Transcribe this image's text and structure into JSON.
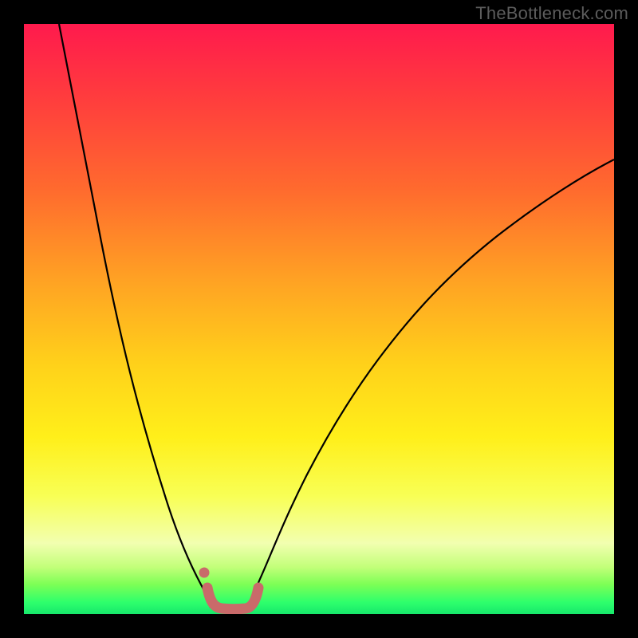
{
  "watermark": "TheBottleneck.com",
  "chart_data": {
    "type": "line",
    "title": "",
    "xlabel": "",
    "ylabel": "",
    "xlim": [
      0,
      100
    ],
    "ylim": [
      0,
      100
    ],
    "grid": false,
    "legend": false,
    "series": [
      {
        "name": "left-curve",
        "color": "#000000",
        "x": [
          6,
          8,
          10,
          12,
          14,
          16,
          18,
          20,
          22,
          24,
          26,
          28,
          30,
          31.5
        ],
        "y": [
          100,
          89,
          78,
          68,
          58,
          49,
          40,
          32,
          25,
          18,
          12,
          7,
          3,
          1
        ]
      },
      {
        "name": "right-curve",
        "color": "#000000",
        "x": [
          38,
          40,
          44,
          48,
          52,
          56,
          60,
          66,
          72,
          80,
          88,
          96,
          100
        ],
        "y": [
          1,
          3,
          9,
          16,
          23,
          29,
          35,
          42,
          48,
          55,
          61,
          67,
          70
        ]
      },
      {
        "name": "valley-highlight",
        "color": "#c96a6a",
        "stroke_width": 12,
        "x": [
          31,
          32,
          33,
          35,
          37,
          38.5,
          39.5
        ],
        "y": [
          4.5,
          1.5,
          0.8,
          0.8,
          0.8,
          1.5,
          4.5
        ]
      },
      {
        "name": "left-dot",
        "type": "scatter",
        "color": "#c96a6a",
        "x": [
          30.5
        ],
        "y": [
          7
        ]
      }
    ],
    "background_gradient": {
      "type": "vertical",
      "stops": [
        {
          "pos": 0.0,
          "color": "#ff1a4d"
        },
        {
          "pos": 0.44,
          "color": "#ffa423"
        },
        {
          "pos": 0.7,
          "color": "#ffef1a"
        },
        {
          "pos": 0.92,
          "color": "#c3ff7a"
        },
        {
          "pos": 1.0,
          "color": "#17e86b"
        }
      ]
    }
  }
}
